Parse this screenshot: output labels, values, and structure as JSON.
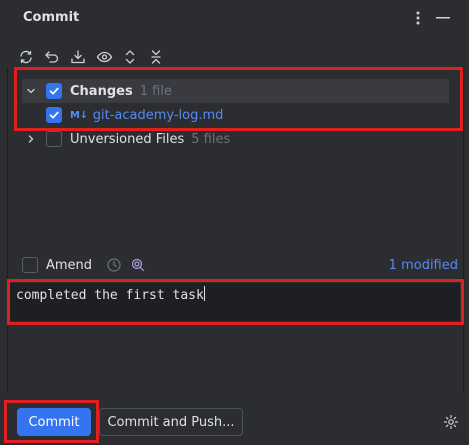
{
  "panel": {
    "title": "Commit"
  },
  "toolbar": {
    "buttons": [
      "refresh-icon",
      "rollback-icon",
      "shelve-icon",
      "show-diff-icon",
      "expand-all-icon",
      "collapse-all-icon"
    ]
  },
  "tree": {
    "changes": {
      "label": "Changes",
      "count": "1 file",
      "checked": true,
      "expanded": true
    },
    "file": {
      "type_badge": "M↓",
      "name": "git-academy-log.md",
      "checked": true
    },
    "unversioned": {
      "label": "Unversioned Files",
      "count": "5 files",
      "checked": false,
      "expanded": false
    }
  },
  "amend": {
    "label": "Amend",
    "checked": false,
    "modified_link": "1 modified"
  },
  "message": {
    "value": "completed the first task"
  },
  "buttons": {
    "commit": "Commit",
    "commit_and_push": "Commit and Push..."
  },
  "colors": {
    "background": "#2b2d30",
    "accent": "#3574f0",
    "link": "#548af7",
    "highlight": "#e02020"
  }
}
